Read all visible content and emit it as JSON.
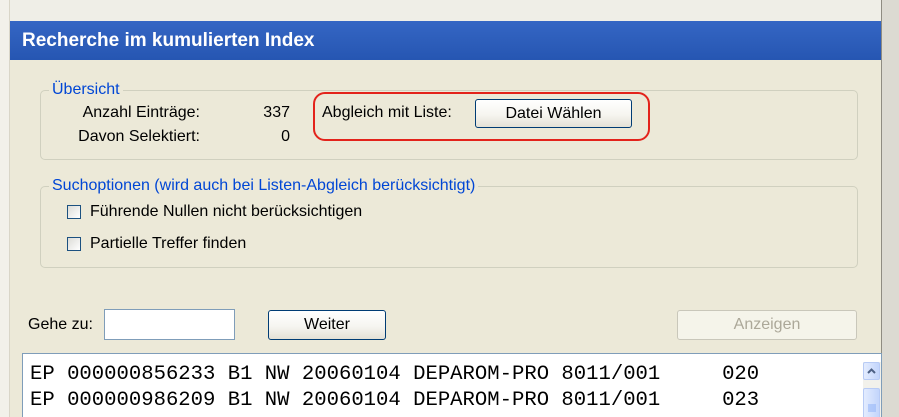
{
  "window": {
    "title": "Recherche im kumulierten Index"
  },
  "overview": {
    "legend": "Übersicht",
    "entries_label": "Anzahl Einträge:",
    "entries_value": "337",
    "selected_label": "Davon Selektiert:",
    "selected_value": "0",
    "compare_label": "Abgleich mit Liste:",
    "choose_file_label": "Datei Wählen"
  },
  "search_options": {
    "legend": "Suchoptionen (wird auch bei Listen-Abgleich berücksichtigt)",
    "options": [
      {
        "label": "Führende Nullen nicht berücksichtigen",
        "checked": false
      },
      {
        "label": "Partielle Treffer finden",
        "checked": false
      }
    ]
  },
  "navigation": {
    "goto_label": "Gehe zu:",
    "goto_value": "",
    "next_label": "Weiter",
    "show_label": "Anzeigen",
    "show_enabled": false
  },
  "results": {
    "rows": [
      "EP 000000856233 B1 NW 20060104 DEPAROM-PRO 8011/001     020",
      "EP 000000986209 B1 NW 20060104 DEPAROM-PRO 8011/001     023"
    ]
  },
  "icons": {
    "scroll_up": "chevron-up-icon",
    "scroll_thumb_grip": "grip-lines-icon"
  },
  "colors": {
    "legend_text": "#0046D5",
    "annotation_highlight": "#E3231B",
    "window_background": "#ECE9D8"
  }
}
